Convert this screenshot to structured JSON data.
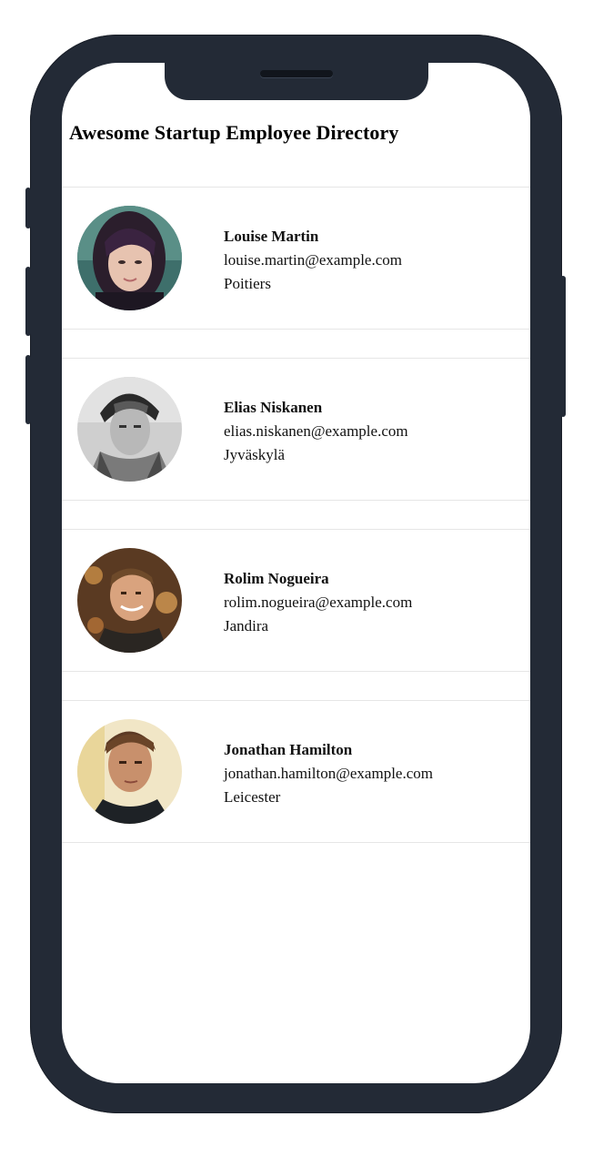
{
  "header": {
    "title": "Awesome Startup Employee Directory"
  },
  "employees": [
    {
      "name": "Louise Martin",
      "email": "louise.martin@example.com",
      "city": "Poitiers"
    },
    {
      "name": "Elias Niskanen",
      "email": "elias.niskanen@example.com",
      "city": "Jyväskylä"
    },
    {
      "name": "Rolim Nogueira",
      "email": "rolim.nogueira@example.com",
      "city": "Jandira"
    },
    {
      "name": "Jonathan Hamilton",
      "email": "jonathan.hamilton@example.com",
      "city": "Leicester"
    }
  ],
  "colors": {
    "device_frame": "#232a36",
    "screen_bg": "#ffffff",
    "divider": "#e6e6e6",
    "text": "#111111"
  }
}
